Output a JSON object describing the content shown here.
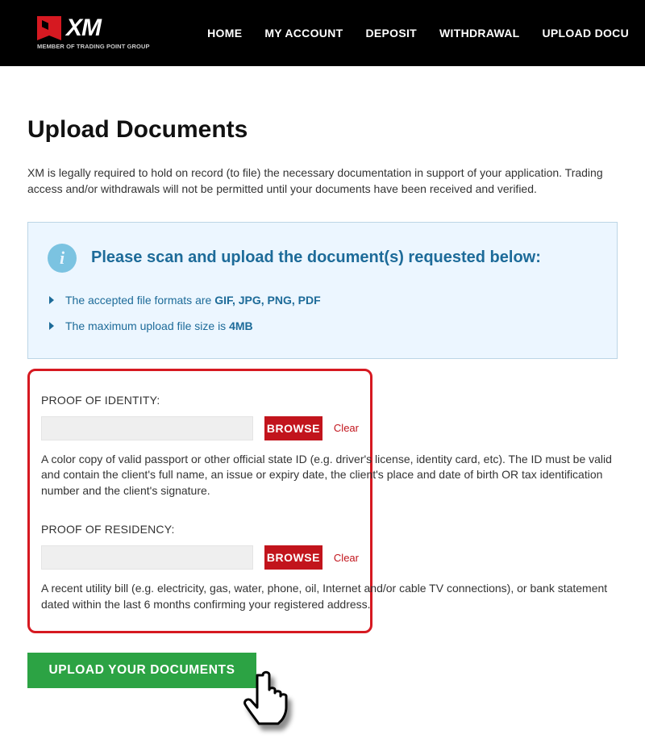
{
  "header": {
    "logo_text": "XM",
    "logo_tag": "MEMBER OF TRADING POINT GROUP",
    "nav": [
      "HOME",
      "MY ACCOUNT",
      "DEPOSIT",
      "WITHDRAWAL",
      "UPLOAD DOCU"
    ]
  },
  "page": {
    "title": "Upload Documents",
    "intro": "XM is legally required to hold on record (to file) the necessary documentation in support of your application. Trading access and/or withdrawals will not be permitted until your documents have been received and verified."
  },
  "callout": {
    "title": "Please scan and upload the document(s) requested below:",
    "items": [
      {
        "prefix": "The accepted file formats are ",
        "bold": "GIF, JPG, PNG, PDF"
      },
      {
        "prefix": "The maximum upload file size is ",
        "bold": "4MB"
      }
    ]
  },
  "form": {
    "browse_label": "BROWSE",
    "clear_label": "Clear",
    "submit_label": "UPLOAD YOUR DOCUMENTS",
    "fields": [
      {
        "label": "PROOF OF IDENTITY:",
        "desc": "A color copy of valid passport or other official state ID (e.g. driver's license, identity card, etc). The ID must be valid and contain the client's full name, an issue or expiry date, the client's place and date of birth OR tax identification number and the client's signature."
      },
      {
        "label": "PROOF OF RESIDENCY:",
        "desc": "A recent utility bill (e.g. electricity, gas, water, phone, oil, Internet and/or cable TV connections), or bank statement dated within the last 6 months confirming your registered address."
      }
    ]
  }
}
